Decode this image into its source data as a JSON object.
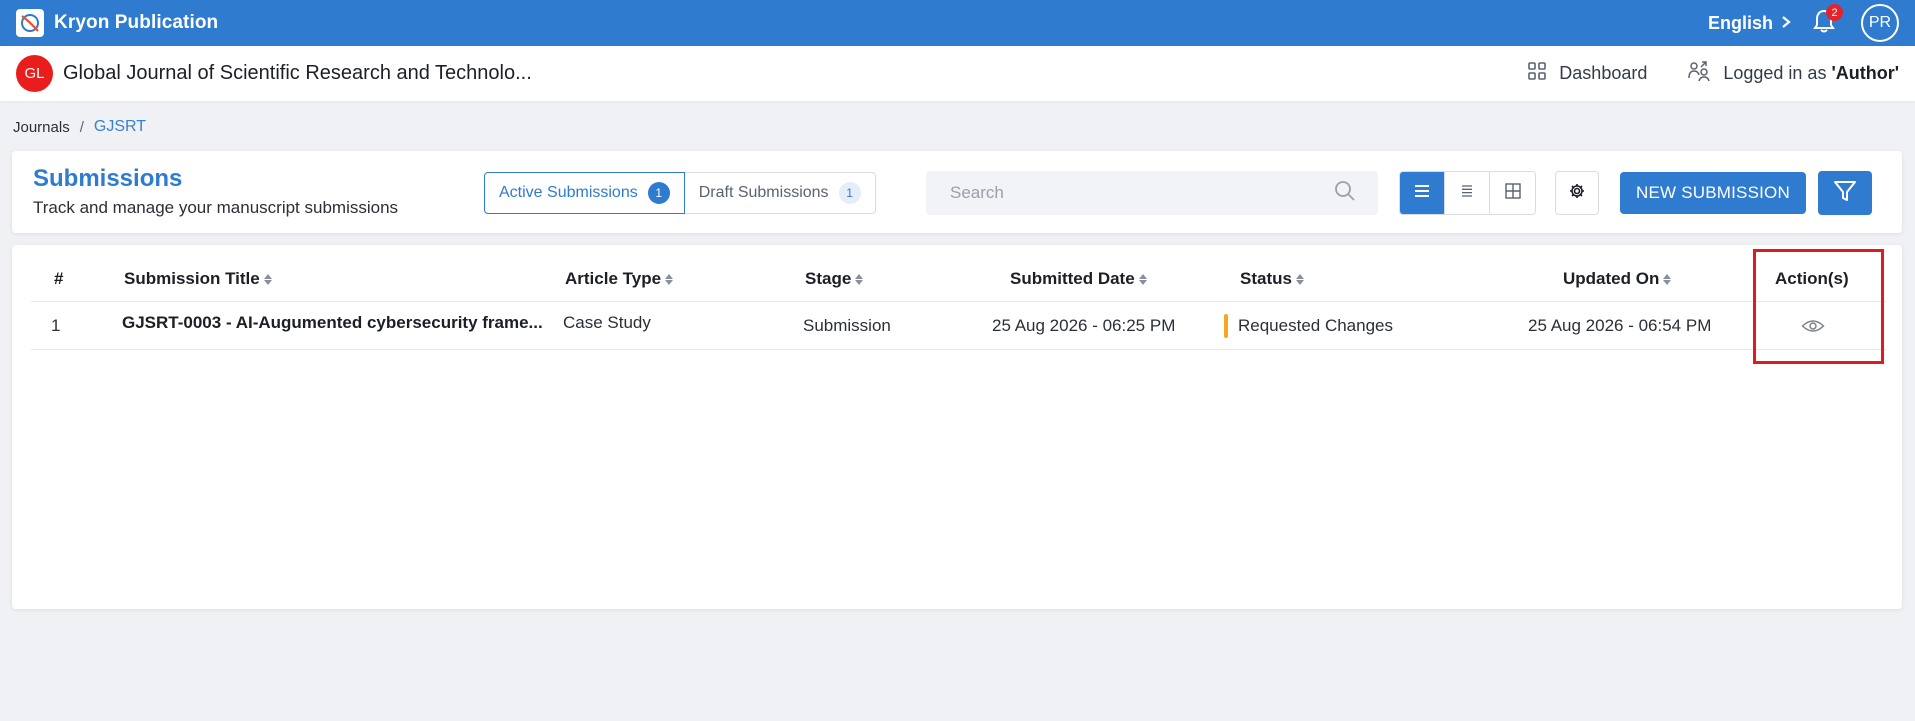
{
  "topbar": {
    "app_name": "Kryon Publication",
    "language": "English",
    "notification_count": "2",
    "user_initials": "PR"
  },
  "journal": {
    "initials": "GL",
    "title": "Global Journal of Scientific Research and Technolo...",
    "dashboard_label": "Dashboard",
    "logged_in_prefix": "Logged in as ",
    "logged_in_role": "'Author'"
  },
  "breadcrumb": {
    "root": "Journals",
    "separator": "/",
    "current": "GJSRT"
  },
  "submissions": {
    "title": "Submissions",
    "subtitle": "Track and manage your manuscript submissions",
    "tabs": [
      {
        "label": "Active Submissions",
        "count": "1"
      },
      {
        "label": "Draft Submissions",
        "count": "1"
      }
    ],
    "search_placeholder": "Search",
    "new_button": "NEW SUBMISSION"
  },
  "table": {
    "headers": {
      "num": "#",
      "title": "Submission Title",
      "article_type": "Article Type",
      "stage": "Stage",
      "submitted_date": "Submitted Date",
      "status": "Status",
      "updated_on": "Updated On",
      "actions": "Action(s)"
    },
    "rows": [
      {
        "num": "1",
        "title": "GJSRT-0003 - AI-Augumented cybersecurity frame...",
        "article_type": "Case Study",
        "stage": "Submission",
        "submitted_date": "25 Aug 2026 - 06:25 PM",
        "status": "Requested Changes",
        "updated_on": "25 Aug 2026 - 06:54 PM"
      }
    ]
  },
  "colors": {
    "brand": "#2f7bd0",
    "status_requested_changes": "#f5a623",
    "highlight": "#e01b1b",
    "journal_avatar": "#ea1d1d"
  }
}
